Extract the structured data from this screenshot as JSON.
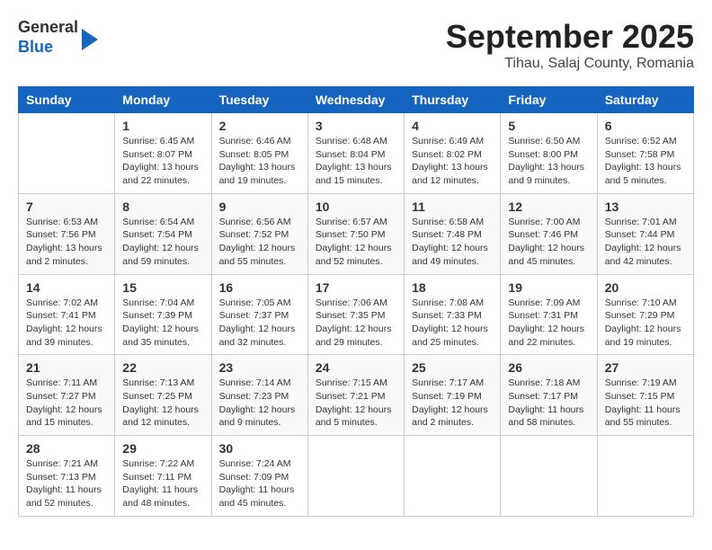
{
  "header": {
    "logo": {
      "line1": "General",
      "line2": "Blue"
    },
    "month": "September 2025",
    "location": "Tihau, Salaj County, Romania"
  },
  "weekdays": [
    "Sunday",
    "Monday",
    "Tuesday",
    "Wednesday",
    "Thursday",
    "Friday",
    "Saturday"
  ],
  "weeks": [
    [
      {
        "day": "",
        "info": ""
      },
      {
        "day": "1",
        "info": "Sunrise: 6:45 AM\nSunset: 8:07 PM\nDaylight: 13 hours\nand 22 minutes."
      },
      {
        "day": "2",
        "info": "Sunrise: 6:46 AM\nSunset: 8:05 PM\nDaylight: 13 hours\nand 19 minutes."
      },
      {
        "day": "3",
        "info": "Sunrise: 6:48 AM\nSunset: 8:04 PM\nDaylight: 13 hours\nand 15 minutes."
      },
      {
        "day": "4",
        "info": "Sunrise: 6:49 AM\nSunset: 8:02 PM\nDaylight: 13 hours\nand 12 minutes."
      },
      {
        "day": "5",
        "info": "Sunrise: 6:50 AM\nSunset: 8:00 PM\nDaylight: 13 hours\nand 9 minutes."
      },
      {
        "day": "6",
        "info": "Sunrise: 6:52 AM\nSunset: 7:58 PM\nDaylight: 13 hours\nand 5 minutes."
      }
    ],
    [
      {
        "day": "7",
        "info": "Sunrise: 6:53 AM\nSunset: 7:56 PM\nDaylight: 13 hours\nand 2 minutes."
      },
      {
        "day": "8",
        "info": "Sunrise: 6:54 AM\nSunset: 7:54 PM\nDaylight: 12 hours\nand 59 minutes."
      },
      {
        "day": "9",
        "info": "Sunrise: 6:56 AM\nSunset: 7:52 PM\nDaylight: 12 hours\nand 55 minutes."
      },
      {
        "day": "10",
        "info": "Sunrise: 6:57 AM\nSunset: 7:50 PM\nDaylight: 12 hours\nand 52 minutes."
      },
      {
        "day": "11",
        "info": "Sunrise: 6:58 AM\nSunset: 7:48 PM\nDaylight: 12 hours\nand 49 minutes."
      },
      {
        "day": "12",
        "info": "Sunrise: 7:00 AM\nSunset: 7:46 PM\nDaylight: 12 hours\nand 45 minutes."
      },
      {
        "day": "13",
        "info": "Sunrise: 7:01 AM\nSunset: 7:44 PM\nDaylight: 12 hours\nand 42 minutes."
      }
    ],
    [
      {
        "day": "14",
        "info": "Sunrise: 7:02 AM\nSunset: 7:41 PM\nDaylight: 12 hours\nand 39 minutes."
      },
      {
        "day": "15",
        "info": "Sunrise: 7:04 AM\nSunset: 7:39 PM\nDaylight: 12 hours\nand 35 minutes."
      },
      {
        "day": "16",
        "info": "Sunrise: 7:05 AM\nSunset: 7:37 PM\nDaylight: 12 hours\nand 32 minutes."
      },
      {
        "day": "17",
        "info": "Sunrise: 7:06 AM\nSunset: 7:35 PM\nDaylight: 12 hours\nand 29 minutes."
      },
      {
        "day": "18",
        "info": "Sunrise: 7:08 AM\nSunset: 7:33 PM\nDaylight: 12 hours\nand 25 minutes."
      },
      {
        "day": "19",
        "info": "Sunrise: 7:09 AM\nSunset: 7:31 PM\nDaylight: 12 hours\nand 22 minutes."
      },
      {
        "day": "20",
        "info": "Sunrise: 7:10 AM\nSunset: 7:29 PM\nDaylight: 12 hours\nand 19 minutes."
      }
    ],
    [
      {
        "day": "21",
        "info": "Sunrise: 7:11 AM\nSunset: 7:27 PM\nDaylight: 12 hours\nand 15 minutes."
      },
      {
        "day": "22",
        "info": "Sunrise: 7:13 AM\nSunset: 7:25 PM\nDaylight: 12 hours\nand 12 minutes."
      },
      {
        "day": "23",
        "info": "Sunrise: 7:14 AM\nSunset: 7:23 PM\nDaylight: 12 hours\nand 9 minutes."
      },
      {
        "day": "24",
        "info": "Sunrise: 7:15 AM\nSunset: 7:21 PM\nDaylight: 12 hours\nand 5 minutes."
      },
      {
        "day": "25",
        "info": "Sunrise: 7:17 AM\nSunset: 7:19 PM\nDaylight: 12 hours\nand 2 minutes."
      },
      {
        "day": "26",
        "info": "Sunrise: 7:18 AM\nSunset: 7:17 PM\nDaylight: 11 hours\nand 58 minutes."
      },
      {
        "day": "27",
        "info": "Sunrise: 7:19 AM\nSunset: 7:15 PM\nDaylight: 11 hours\nand 55 minutes."
      }
    ],
    [
      {
        "day": "28",
        "info": "Sunrise: 7:21 AM\nSunset: 7:13 PM\nDaylight: 11 hours\nand 52 minutes."
      },
      {
        "day": "29",
        "info": "Sunrise: 7:22 AM\nSunset: 7:11 PM\nDaylight: 11 hours\nand 48 minutes."
      },
      {
        "day": "30",
        "info": "Sunrise: 7:24 AM\nSunset: 7:09 PM\nDaylight: 11 hours\nand 45 minutes."
      },
      {
        "day": "",
        "info": ""
      },
      {
        "day": "",
        "info": ""
      },
      {
        "day": "",
        "info": ""
      },
      {
        "day": "",
        "info": ""
      }
    ]
  ]
}
